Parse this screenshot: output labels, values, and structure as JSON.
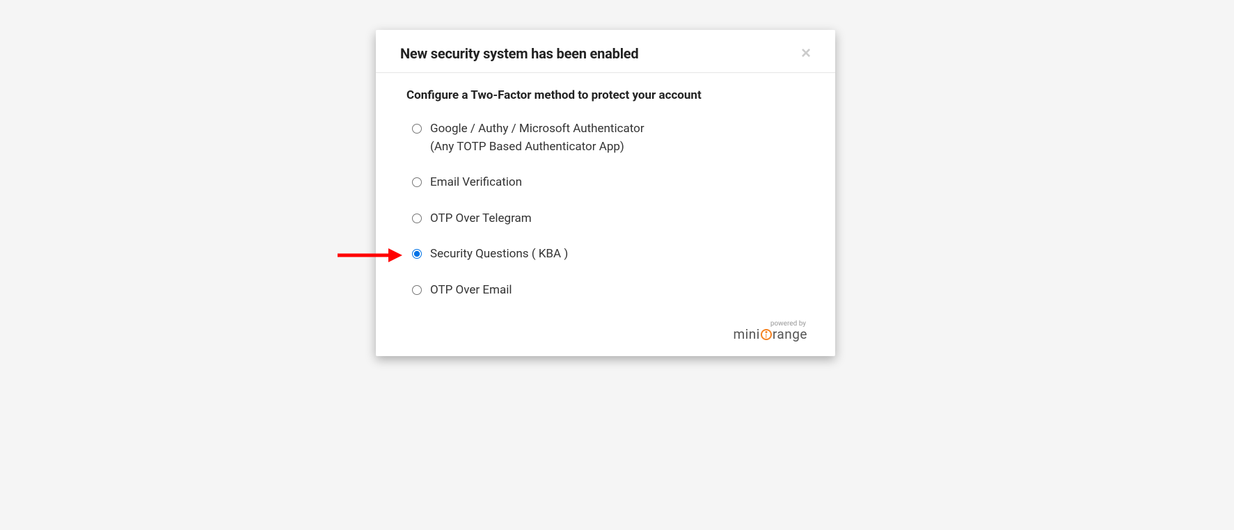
{
  "modal": {
    "title": "New security system has been enabled",
    "subtitle": "Configure a Two-Factor method to protect your account",
    "options": [
      {
        "label": "Google / Authy / Microsoft Authenticator",
        "sublabel": "(Any TOTP Based Authenticator App)",
        "checked": false
      },
      {
        "label": "Email Verification",
        "sublabel": "",
        "checked": false
      },
      {
        "label": "OTP Over Telegram",
        "sublabel": "",
        "checked": false
      },
      {
        "label": "Security Questions ( KBA )",
        "sublabel": "",
        "checked": true
      },
      {
        "label": "OTP Over Email",
        "sublabel": "",
        "checked": false
      }
    ],
    "footer": {
      "powered_by": "powered by",
      "brand_prefix": "mini",
      "brand_suffix": "range"
    }
  }
}
